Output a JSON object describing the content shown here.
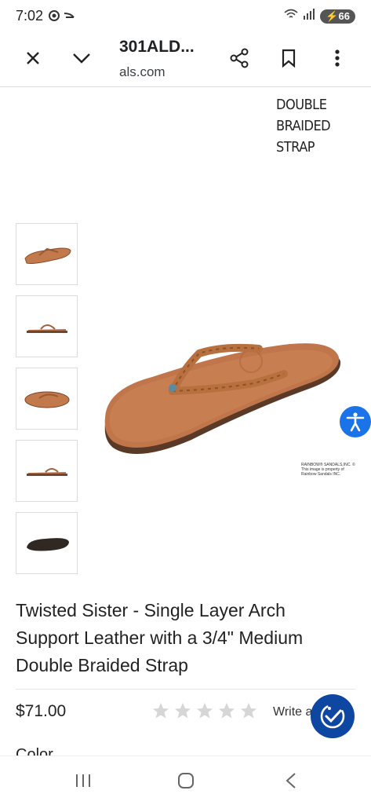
{
  "status_bar": {
    "time": "7:02",
    "battery": "66"
  },
  "toolbar": {
    "title": "301ALD...",
    "url": "als.com"
  },
  "product": {
    "description_text": "DOUBLE\nBRAIDED\nSTRAP",
    "image_copyright": "RAINBOW® SANDALS,INC. ©",
    "image_copyright_sub": "This image is property of Rainbow Sandals INC.",
    "title": "Twisted Sister - Single Layer Arch Support Leather with a 3/4\" Medium Double Braided Strap",
    "price": "$71.00",
    "rating_stars": 0,
    "write_review": "Write a",
    "color_label": "Color"
  },
  "thumbnails": [
    {
      "label": "thumbnail-top-view"
    },
    {
      "label": "thumbnail-side-view"
    },
    {
      "label": "thumbnail-angle-view"
    },
    {
      "label": "thumbnail-profile-view"
    },
    {
      "label": "thumbnail-sole-view"
    }
  ],
  "colors": {
    "leather": "#b86c43",
    "accent_blue": "#1a73e8",
    "chat_blue": "#0d47a1"
  }
}
